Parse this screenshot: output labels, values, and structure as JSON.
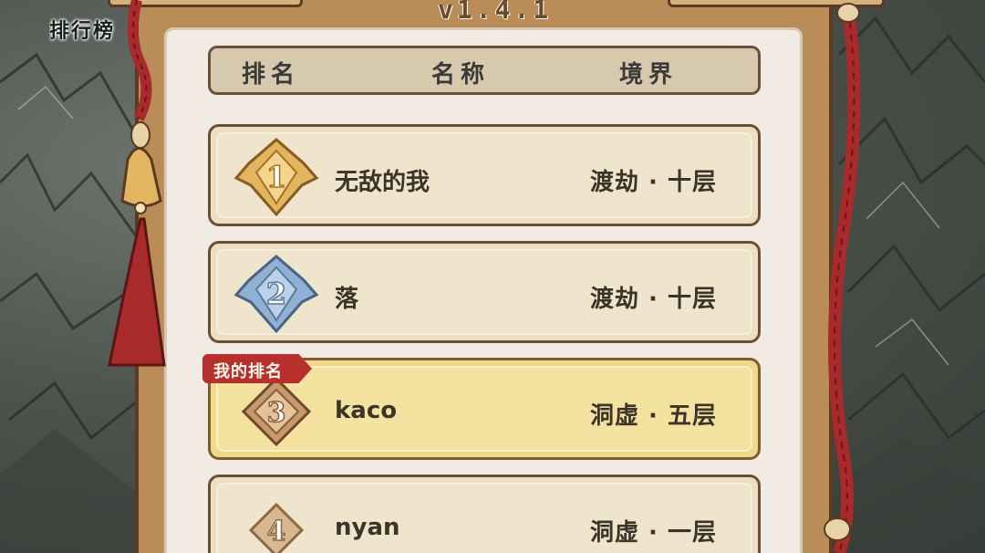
{
  "version": "v1.4.1",
  "corner_title": "排行榜",
  "header": {
    "rank": "排名",
    "name": "名称",
    "realm": "境界"
  },
  "my_rank_tag": "我的排名",
  "rows": [
    {
      "rank": 1,
      "name": "无敌的我",
      "realm": "渡劫 · 十层",
      "medal": "gold"
    },
    {
      "rank": 2,
      "name": "落",
      "realm": "渡劫 · 十层",
      "medal": "silver"
    },
    {
      "rank": 3,
      "name": "kaco",
      "realm": "洞虚 · 五层",
      "medal": "bronze",
      "is_me": true
    },
    {
      "rank": 4,
      "name": "nyan",
      "realm": "洞虚 · 一层",
      "medal": "plain"
    }
  ],
  "colors": {
    "paper": "#f1ebe3",
    "row": "#ecdfc4",
    "row_highlight": "#f1d88a",
    "tag": "#b7302d",
    "rope": "#a82a2a",
    "gold": "#e2b561",
    "silver": "#8fb1d4",
    "bronze": "#c69a6c"
  }
}
